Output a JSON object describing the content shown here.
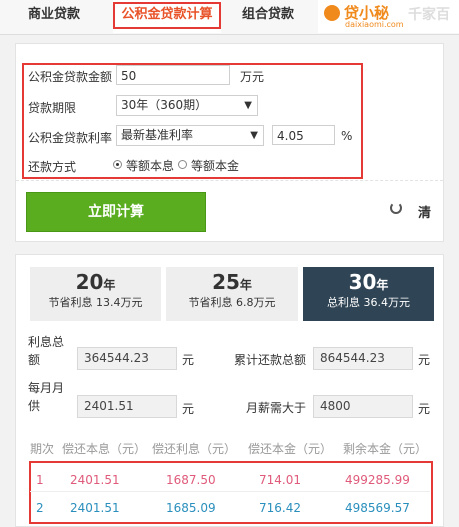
{
  "tabs": {
    "commercial": "商业贷款",
    "provident": "公积金贷款计算",
    "combo": "组合贷款"
  },
  "logo": {
    "name": "贷小秘",
    "url": "daixiaomi.com",
    "ghost": "千家百"
  },
  "form": {
    "amount_label": "公积金贷款金额",
    "amount_value": "50",
    "amount_unit": "万元",
    "term_label": "贷款期限",
    "term_value": "30年（360期）",
    "rate_label": "公积金贷款利率",
    "rate_type": "最新基准利率",
    "rate_value": "4.05",
    "rate_unit": "%",
    "method_label": "还款方式",
    "method_equal_payment": "等额本息",
    "method_equal_principal": "等额本金",
    "selected_method": "等额本息"
  },
  "actions": {
    "calculate": "立即计算",
    "reset": "清"
  },
  "periods": [
    {
      "years": "20",
      "unit": "年",
      "label": "节省利息 13.4万元"
    },
    {
      "years": "25",
      "unit": "年",
      "label": "节省利息 6.8万元"
    },
    {
      "years": "30",
      "unit": "年",
      "label": "总利息 36.4万元"
    }
  ],
  "results": {
    "interest_total_label_a": "利息总",
    "interest_total_label_b": "额",
    "interest_total": "364544.23",
    "unit_yuan": "元",
    "repay_total_label": "累计还款总额",
    "repay_total": "864544.23",
    "monthly_label_a": "每月月",
    "monthly_label_b": "供",
    "monthly": "2401.51",
    "salary_label": "月薪需大于",
    "salary": "4800"
  },
  "schedule": {
    "headers": [
      "期次",
      "偿还本息（元）",
      "偿还利息（元）",
      "偿还本金（元）",
      "剩余本金（元）"
    ],
    "rows": [
      [
        "1",
        "2401.51",
        "1687.50",
        "714.01",
        "499285.99"
      ],
      [
        "2",
        "2401.51",
        "1685.09",
        "716.42",
        "498569.57"
      ]
    ]
  },
  "colors": {
    "accent": "#e8532a",
    "highlight_border": "#e53935",
    "calc_button": "#5aad1e",
    "active_period": "#2f4454",
    "row_odd": "#e05a7a",
    "row_even": "#2a8fbd"
  }
}
